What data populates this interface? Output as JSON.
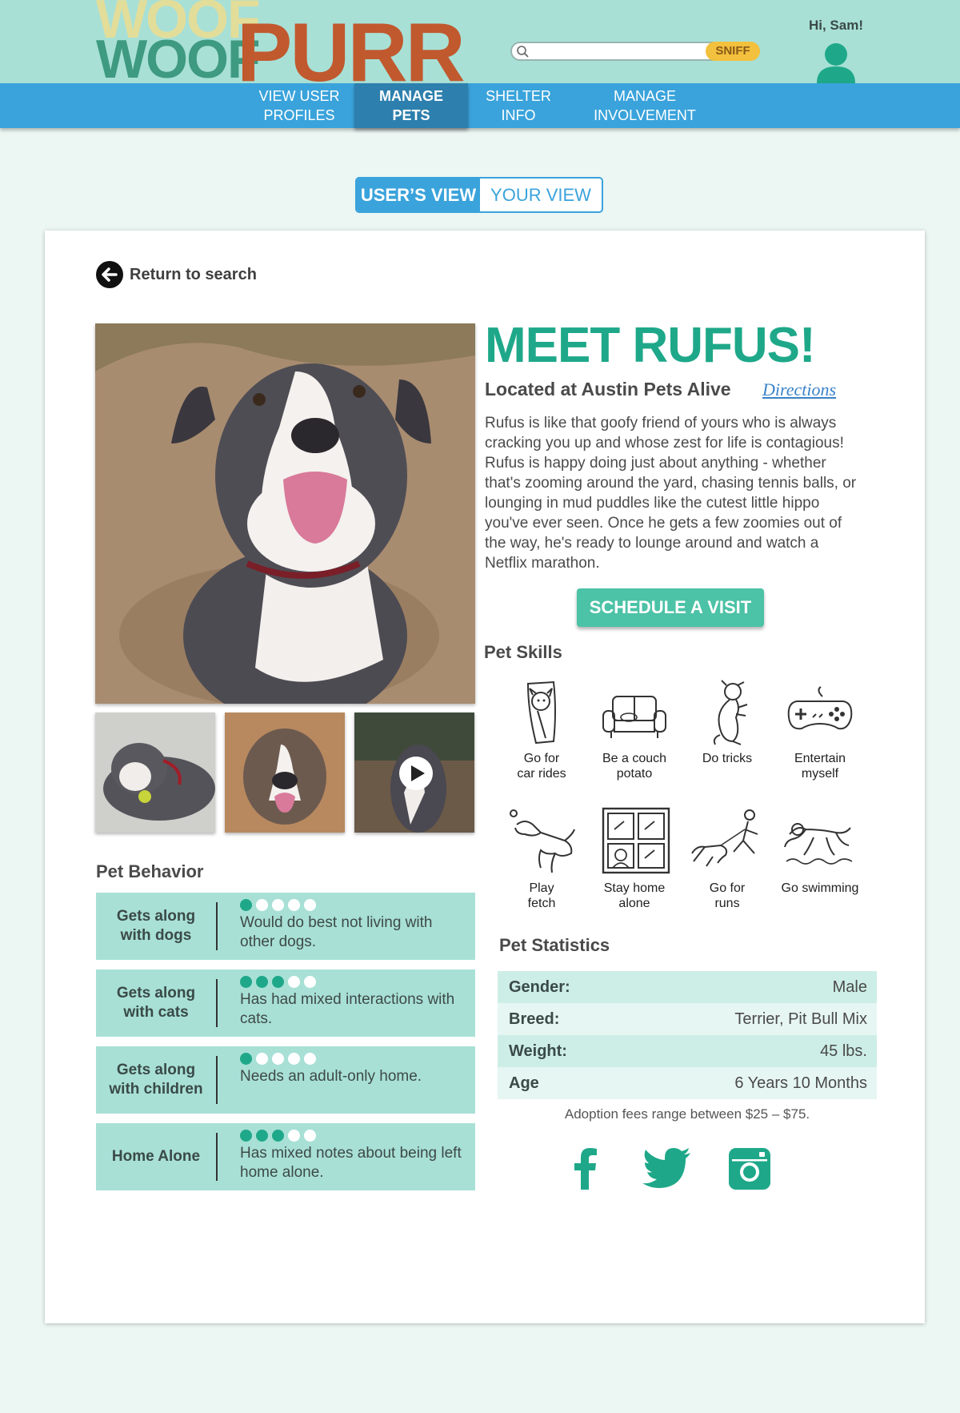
{
  "header": {
    "logo_woof_top": "WOOF",
    "logo_woof_bottom": "WOOF",
    "logo_purr": "PURR",
    "search_placeholder": "",
    "search_button": "SNIFF",
    "greeting": "Hi, Sam!"
  },
  "nav": {
    "items": [
      {
        "line1": "VIEW USER",
        "line2": "PROFILES"
      },
      {
        "line1": "MANAGE",
        "line2": "PETS"
      },
      {
        "line1": "SHELTER",
        "line2": "INFO"
      },
      {
        "line1": "MANAGE",
        "line2": "INVOLVEMENT"
      }
    ],
    "active_index": 1
  },
  "view_toggle": {
    "users_view": "USER’S VIEW",
    "your_view": "YOUR VIEW",
    "selected": "users_view"
  },
  "back_link": "Return to search",
  "pet": {
    "title": "MEET RUFUS!",
    "location": "Located at Austin Pets Alive",
    "directions": "Directions",
    "description": "Rufus is like that goofy friend of yours who is always cracking you up and whose zest for life is contagious!  Rufus is happy doing just about anything - whether that's zooming around the yard, chasing tennis balls, or lounging in mud puddles like the cutest little hippo you've ever seen. Once he gets a few zoomies out of the way, he's ready to lounge around and watch a Netflix marathon.",
    "schedule_button": "SCHEDULE A VISIT"
  },
  "behavior": {
    "heading": "Pet Behavior",
    "rows": [
      {
        "label_1": "Gets along",
        "label_2": "with dogs",
        "rating": 1,
        "max": 5,
        "note": "Would do best not living with other dogs."
      },
      {
        "label_1": "Gets along",
        "label_2": "with cats",
        "rating": 3,
        "max": 5,
        "note": "Has had mixed interactions with cats."
      },
      {
        "label_1": "Gets along",
        "label_2": "with children",
        "rating": 1,
        "max": 5,
        "note": "Needs an adult-only home."
      },
      {
        "label_1": "Home Alone",
        "label_2": "",
        "rating": 3,
        "max": 5,
        "note": "Has mixed notes about being left home alone."
      }
    ]
  },
  "skills": {
    "heading": "Pet Skills",
    "items": [
      {
        "icon": "car-ride-dog-icon",
        "line1": "Go for",
        "line2": "car rides"
      },
      {
        "icon": "couch-icon",
        "line1": "Be a couch",
        "line2": "potato"
      },
      {
        "icon": "tricks-dog-icon",
        "line1": "Do tricks",
        "line2": ""
      },
      {
        "icon": "game-controller-icon",
        "line1": "Entertain",
        "line2": "myself"
      },
      {
        "icon": "fetch-dog-icon",
        "line1": "Play",
        "line2": "fetch"
      },
      {
        "icon": "window-dog-icon",
        "line1": "Stay home",
        "line2": "alone"
      },
      {
        "icon": "running-dog-icon",
        "line1": "Go for",
        "line2": "runs"
      },
      {
        "icon": "swimming-dog-icon",
        "line1": "Go swimming",
        "line2": ""
      }
    ]
  },
  "statistics": {
    "heading": "Pet Statistics",
    "rows": [
      {
        "key": "Gender:",
        "value": "Male"
      },
      {
        "key": "Breed:",
        "value": "Terrier, Pit Bull Mix"
      },
      {
        "key": "Weight:",
        "value": "45 lbs."
      },
      {
        "key": "Age",
        "value": "6 Years 10 Months"
      }
    ],
    "fees": "Adoption fees range between $25 – $75."
  },
  "colors": {
    "header_bg": "#a8e0d6",
    "nav_bg": "#3aa3db",
    "nav_active": "#2d7fad",
    "accent_green": "#1ea889",
    "button_green": "#4cc2a6",
    "logo_orange": "#c1592e",
    "sniff_yellow": "#f3c13d"
  },
  "social_icons": [
    "facebook-icon",
    "twitter-icon",
    "instagram-icon"
  ]
}
